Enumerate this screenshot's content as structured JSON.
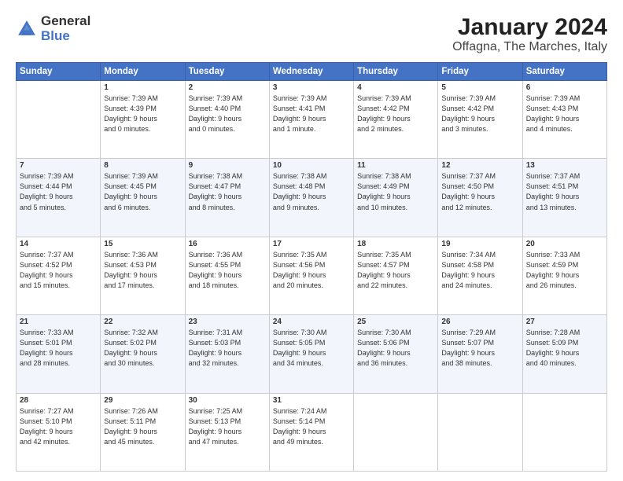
{
  "logo": {
    "line1": "General",
    "line2": "Blue"
  },
  "title": "January 2024",
  "subtitle": "Offagna, The Marches, Italy",
  "days_of_week": [
    "Sunday",
    "Monday",
    "Tuesday",
    "Wednesday",
    "Thursday",
    "Friday",
    "Saturday"
  ],
  "weeks": [
    [
      {
        "day": "",
        "info": ""
      },
      {
        "day": "1",
        "info": "Sunrise: 7:39 AM\nSunset: 4:39 PM\nDaylight: 9 hours\nand 0 minutes."
      },
      {
        "day": "2",
        "info": "Sunrise: 7:39 AM\nSunset: 4:40 PM\nDaylight: 9 hours\nand 0 minutes."
      },
      {
        "day": "3",
        "info": "Sunrise: 7:39 AM\nSunset: 4:41 PM\nDaylight: 9 hours\nand 1 minute."
      },
      {
        "day": "4",
        "info": "Sunrise: 7:39 AM\nSunset: 4:42 PM\nDaylight: 9 hours\nand 2 minutes."
      },
      {
        "day": "5",
        "info": "Sunrise: 7:39 AM\nSunset: 4:42 PM\nDaylight: 9 hours\nand 3 minutes."
      },
      {
        "day": "6",
        "info": "Sunrise: 7:39 AM\nSunset: 4:43 PM\nDaylight: 9 hours\nand 4 minutes."
      }
    ],
    [
      {
        "day": "7",
        "info": "Sunrise: 7:39 AM\nSunset: 4:44 PM\nDaylight: 9 hours\nand 5 minutes."
      },
      {
        "day": "8",
        "info": "Sunrise: 7:39 AM\nSunset: 4:45 PM\nDaylight: 9 hours\nand 6 minutes."
      },
      {
        "day": "9",
        "info": "Sunrise: 7:38 AM\nSunset: 4:47 PM\nDaylight: 9 hours\nand 8 minutes."
      },
      {
        "day": "10",
        "info": "Sunrise: 7:38 AM\nSunset: 4:48 PM\nDaylight: 9 hours\nand 9 minutes."
      },
      {
        "day": "11",
        "info": "Sunrise: 7:38 AM\nSunset: 4:49 PM\nDaylight: 9 hours\nand 10 minutes."
      },
      {
        "day": "12",
        "info": "Sunrise: 7:37 AM\nSunset: 4:50 PM\nDaylight: 9 hours\nand 12 minutes."
      },
      {
        "day": "13",
        "info": "Sunrise: 7:37 AM\nSunset: 4:51 PM\nDaylight: 9 hours\nand 13 minutes."
      }
    ],
    [
      {
        "day": "14",
        "info": "Sunrise: 7:37 AM\nSunset: 4:52 PM\nDaylight: 9 hours\nand 15 minutes."
      },
      {
        "day": "15",
        "info": "Sunrise: 7:36 AM\nSunset: 4:53 PM\nDaylight: 9 hours\nand 17 minutes."
      },
      {
        "day": "16",
        "info": "Sunrise: 7:36 AM\nSunset: 4:55 PM\nDaylight: 9 hours\nand 18 minutes."
      },
      {
        "day": "17",
        "info": "Sunrise: 7:35 AM\nSunset: 4:56 PM\nDaylight: 9 hours\nand 20 minutes."
      },
      {
        "day": "18",
        "info": "Sunrise: 7:35 AM\nSunset: 4:57 PM\nDaylight: 9 hours\nand 22 minutes."
      },
      {
        "day": "19",
        "info": "Sunrise: 7:34 AM\nSunset: 4:58 PM\nDaylight: 9 hours\nand 24 minutes."
      },
      {
        "day": "20",
        "info": "Sunrise: 7:33 AM\nSunset: 4:59 PM\nDaylight: 9 hours\nand 26 minutes."
      }
    ],
    [
      {
        "day": "21",
        "info": "Sunrise: 7:33 AM\nSunset: 5:01 PM\nDaylight: 9 hours\nand 28 minutes."
      },
      {
        "day": "22",
        "info": "Sunrise: 7:32 AM\nSunset: 5:02 PM\nDaylight: 9 hours\nand 30 minutes."
      },
      {
        "day": "23",
        "info": "Sunrise: 7:31 AM\nSunset: 5:03 PM\nDaylight: 9 hours\nand 32 minutes."
      },
      {
        "day": "24",
        "info": "Sunrise: 7:30 AM\nSunset: 5:05 PM\nDaylight: 9 hours\nand 34 minutes."
      },
      {
        "day": "25",
        "info": "Sunrise: 7:30 AM\nSunset: 5:06 PM\nDaylight: 9 hours\nand 36 minutes."
      },
      {
        "day": "26",
        "info": "Sunrise: 7:29 AM\nSunset: 5:07 PM\nDaylight: 9 hours\nand 38 minutes."
      },
      {
        "day": "27",
        "info": "Sunrise: 7:28 AM\nSunset: 5:09 PM\nDaylight: 9 hours\nand 40 minutes."
      }
    ],
    [
      {
        "day": "28",
        "info": "Sunrise: 7:27 AM\nSunset: 5:10 PM\nDaylight: 9 hours\nand 42 minutes."
      },
      {
        "day": "29",
        "info": "Sunrise: 7:26 AM\nSunset: 5:11 PM\nDaylight: 9 hours\nand 45 minutes."
      },
      {
        "day": "30",
        "info": "Sunrise: 7:25 AM\nSunset: 5:13 PM\nDaylight: 9 hours\nand 47 minutes."
      },
      {
        "day": "31",
        "info": "Sunrise: 7:24 AM\nSunset: 5:14 PM\nDaylight: 9 hours\nand 49 minutes."
      },
      {
        "day": "",
        "info": ""
      },
      {
        "day": "",
        "info": ""
      },
      {
        "day": "",
        "info": ""
      }
    ]
  ]
}
